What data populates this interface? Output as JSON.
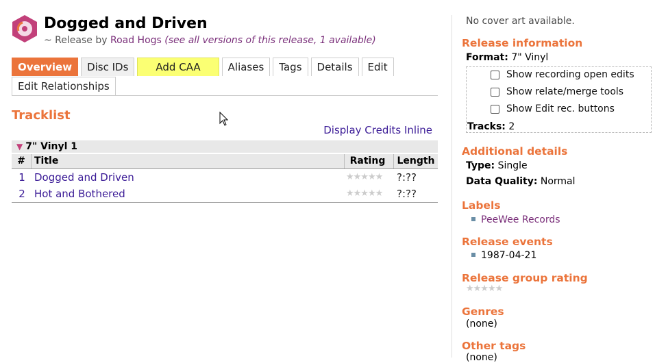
{
  "release": {
    "title": "Dogged and Driven",
    "subtitle_prefix": "~ Release by",
    "artist": "Road Hogs",
    "versions_note": "(see all versions of this release, 1 available)"
  },
  "tabs": [
    {
      "label": "Overview",
      "active": true
    },
    {
      "label": "Disc IDs"
    },
    {
      "label": "Add CAA"
    },
    {
      "label": "Aliases"
    },
    {
      "label": "Tags"
    },
    {
      "label": "Details"
    },
    {
      "label": "Edit"
    },
    {
      "label": "Edit Relationships"
    }
  ],
  "tracklist": {
    "heading": "Tracklist",
    "credits_link": "Display Credits Inline",
    "disc_label": "7\" Vinyl 1",
    "columns": [
      "#",
      "Title",
      "Rating",
      "Length"
    ],
    "rows": [
      {
        "num": "1",
        "title": "Dogged and Driven",
        "rating": "★★★★★",
        "length": "?:??"
      },
      {
        "num": "2",
        "title": "Hot and Bothered",
        "rating": "★★★★★",
        "length": "?:??"
      }
    ]
  },
  "sidebar": {
    "cover_note": "No cover art available.",
    "release_info_heading": "Release information",
    "format_label": "Format:",
    "format_value": "7\" Vinyl",
    "options": [
      {
        "label": "Show recording open edits",
        "checked": false
      },
      {
        "label": "Show relate/merge tools",
        "checked": false
      },
      {
        "label": "Show Edit rec. buttons",
        "checked": false
      }
    ],
    "tracks_label": "Tracks:",
    "tracks_value": "2",
    "additional_heading": "Additional details",
    "type_label": "Type:",
    "type_value": "Single",
    "quality_label": "Data Quality:",
    "quality_value": "Normal",
    "labels_heading": "Labels",
    "label_item": "PeeWee Records",
    "events_heading": "Release events",
    "event_item": "1987-04-21",
    "rg_rating_heading": "Release group rating",
    "rg_rating_stars": "★★★★★",
    "genres_heading": "Genres",
    "genres_value": "(none)",
    "other_tags_heading": "Other tags",
    "other_tags_value": "(none)"
  },
  "colors": {
    "accent": "#eb743b",
    "link": "#3a1a96",
    "artist_link": "#7a2f7a",
    "add_caa_bg": "#fbff73"
  },
  "icons": {
    "logo": "release-logo-icon",
    "disc_toggle": "triangle-down-icon",
    "cursor": "mouse-cursor-icon"
  }
}
